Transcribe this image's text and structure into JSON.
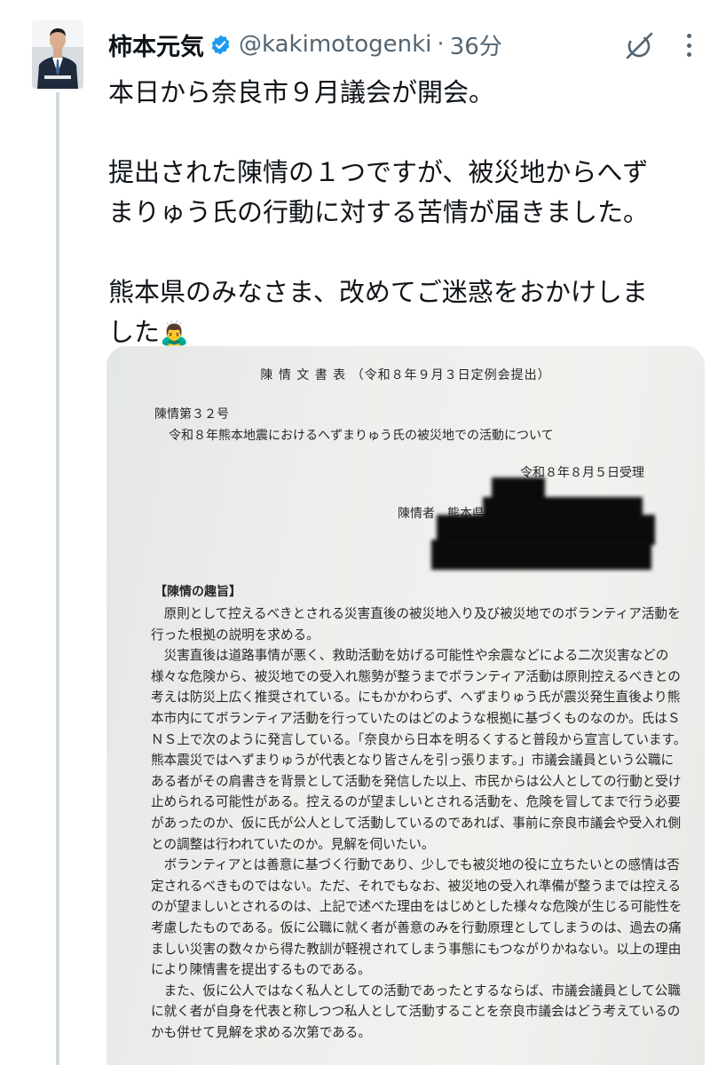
{
  "tweet": {
    "display_name": "柿本元気",
    "handle": "@kakimotogenki",
    "separator": "·",
    "time": "36分",
    "verified_color": "#1d9bf0",
    "paragraphs": [
      "本日から奈良市９月議会が開会。",
      "提出された陳情の１つですが、被災地からへず",
      "まりゅう氏の行動に対する苦情が届きました。",
      "熊本県のみなさま、改めてご迷惑をおかけしま",
      "した"
    ],
    "emoji": "🙇‍♂️"
  },
  "document": {
    "title": "陳 情 文 書 表 （令和８年９月３日定例会提出）",
    "number": "陳情第３２号",
    "subject": "令和８年熊本地震におけるへずまりゅう氏の被災地での活動について",
    "received": "令和８年８月５日受理",
    "petitioner": "陳情者　熊本県",
    "heading": "【陳情の趣旨】",
    "lines": [
      "　原則として控えるべきとされる災害直後の被災地入り及び被災地でのボランティア活動を",
      "行った根拠の説明を求める。",
      "　災害直後は道路事情が悪く、救助活動を妨げる可能性や余震などによる二次災害などの",
      "様々な危険から、被災地での受入れ態勢が整うまでボランティア活動は原則控えるべきとの",
      "考えは防災上広く推奨されている。にもかかわらず、へずまりゅう氏が震災発生直後より熊",
      "本市内にてボランティア活動を行っていたのはどのような根拠に基づくものなのか。氏はＳ",
      "ＮＳ上で次のように発言している。「奈良から日本を明るくすると普段から宣言しています。",
      "熊本震災ではへずまりゅうが代表となり皆さんを引っ張ります。」市議会議員という公職に",
      "ある者がその肩書きを背景として活動を発信した以上、市民からは公人としての行動と受け",
      "止められる可能性がある。控えるのが望ましいとされる活動を、危険を冒してまで行う必要",
      "があったのか、仮に氏が公人として活動しているのであれば、事前に奈良市議会や受入れ側",
      "との調整は行われていたのか。見解を伺いたい。",
      "　ボランティアとは善意に基づく行動であり、少しでも被災地の役に立ちたいとの感情は否",
      "定されるべきものではない。ただ、それでもなお、被災地の受入れ準備が整うまでは控える",
      "のが望ましいとされるのは、上記で述べた理由をはじめとした様々な危険が生じる可能性を",
      "考慮したものである。仮に公職に就く者が善意のみを行動原理としてしまうのは、過去の痛",
      "ましい災害の数々から得た教訓が軽視されてしまう事態にもつながりかねない。以上の理由",
      "により陳情書を提出するものである。",
      "　また、仮に公人ではなく私人としての活動であったとするならば、市議会議員として公職",
      "に就く者が自身を代表と称しつつ私人として活動することを奈良市議会はどう考えているの",
      "かも併せて見解を求める次第である。"
    ]
  }
}
